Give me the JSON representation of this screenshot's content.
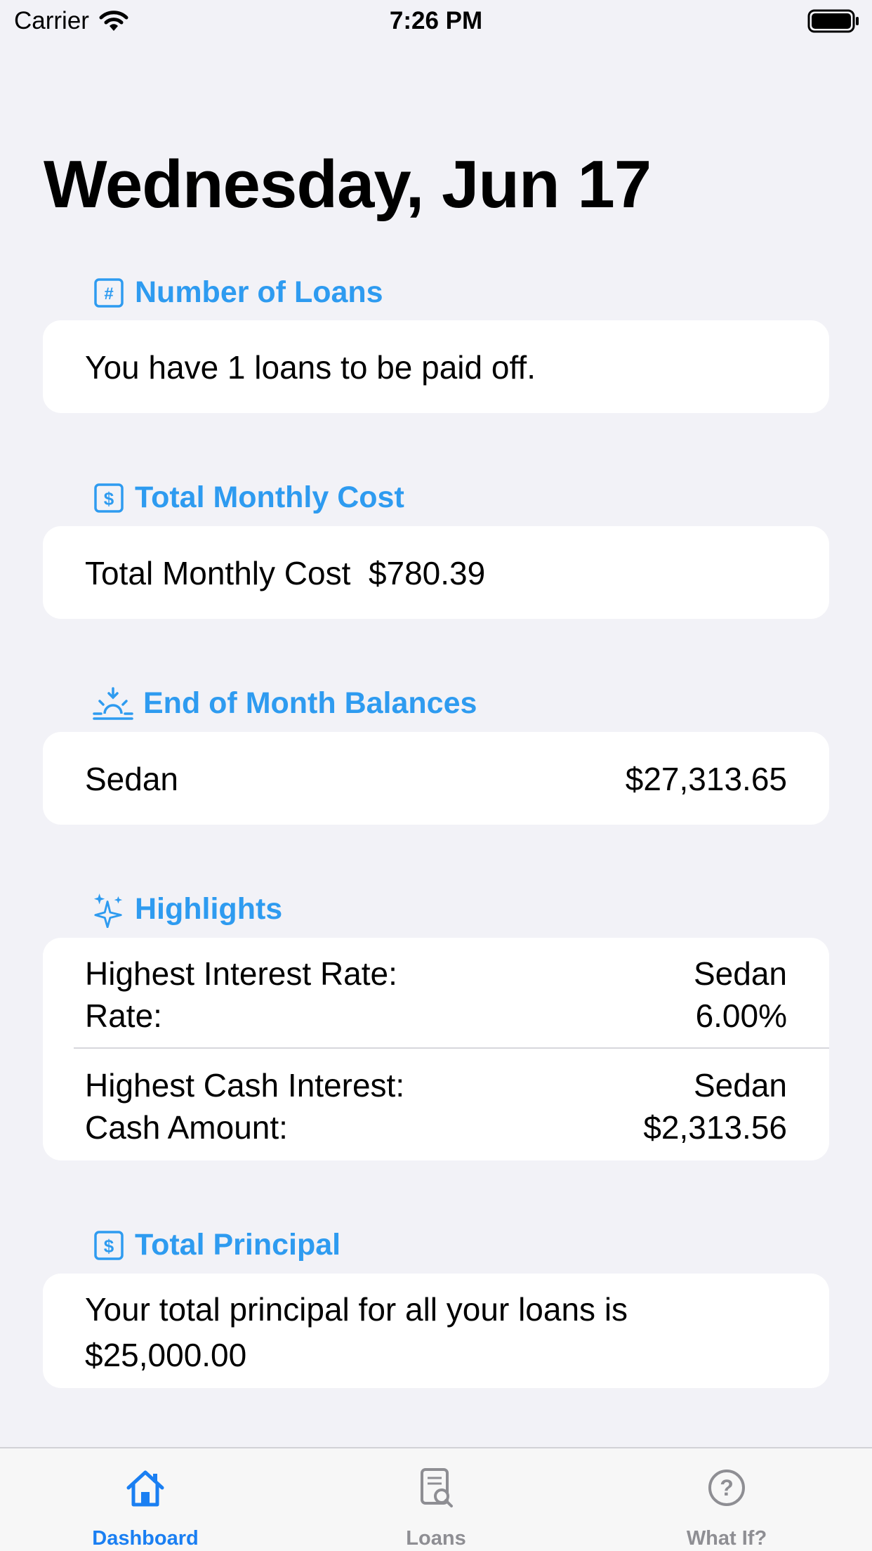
{
  "status_bar": {
    "carrier": "Carrier",
    "time": "7:26 PM"
  },
  "title": "Wednesday, Jun 17",
  "sections": {
    "loans": {
      "header": "Number of Loans",
      "text": "You have 1 loans to be paid off."
    },
    "monthly_cost": {
      "header": "Total Monthly Cost",
      "text": "Total Monthly Cost  $780.39"
    },
    "balances": {
      "header": "End of Month Balances",
      "name": "Sedan",
      "value": "$27,313.65"
    },
    "highlights": {
      "header": "Highlights",
      "rate_label": "Highest Interest Rate:",
      "rate_name": "Sedan",
      "rate_sub_label": "Rate:",
      "rate_value": "6.00%",
      "cash_label": "Highest Cash Interest:",
      "cash_name": "Sedan",
      "cash_sub_label": "Cash Amount:",
      "cash_value": "$2,313.56"
    },
    "principal": {
      "header": "Total Principal",
      "line1": "Your total principal for all your loans is",
      "line2": "$25,000.00"
    }
  },
  "tabs": [
    {
      "label": "Dashboard",
      "icon": "house-icon",
      "active": true
    },
    {
      "label": "Loans",
      "icon": "doc-search-icon",
      "active": false
    },
    {
      "label": "What If?",
      "icon": "question-circle-icon",
      "active": false
    }
  ],
  "colors": {
    "accent": "#2e9bf0",
    "tab_active": "#1a7ff2",
    "tab_inactive": "#8e8e93",
    "background": "#f2f2f7"
  }
}
